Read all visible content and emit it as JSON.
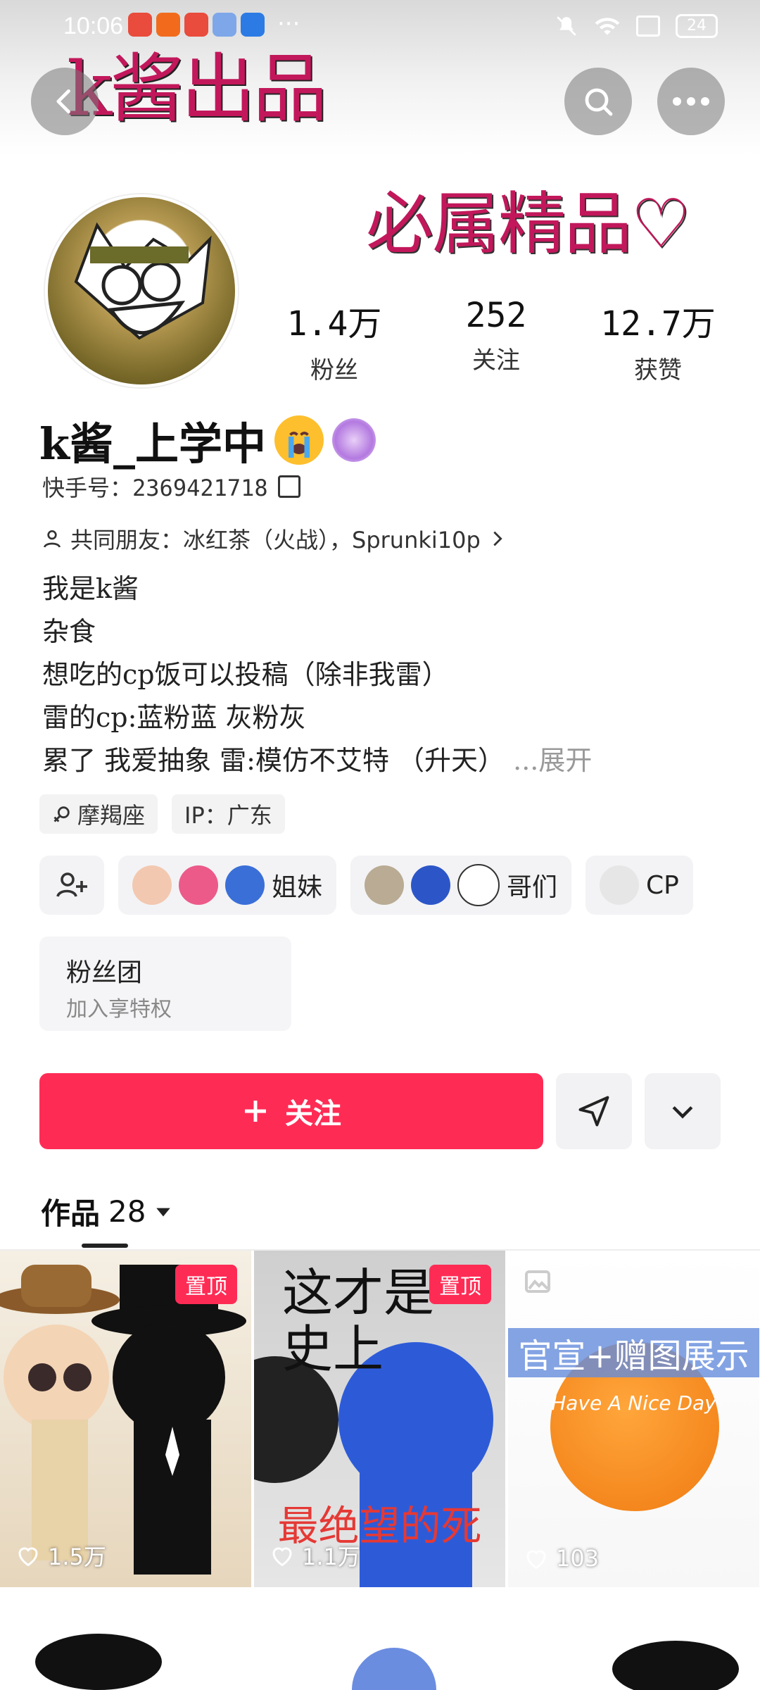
{
  "status_bar": {
    "time": "10:06",
    "battery": "24",
    "app_icons": [
      "huawei-app-icon",
      "233-app-icon",
      "huawei-app-icon",
      "game-app-icon",
      "baidu-app-icon"
    ],
    "more": "···"
  },
  "banner": {
    "text_top": "k酱出品",
    "text_bottom": "必属精品♡"
  },
  "stats": [
    {
      "value": "1.4万",
      "label": "粉丝"
    },
    {
      "value": "252",
      "label": "关注"
    },
    {
      "value": "12.7万",
      "label": "获赞"
    }
  ],
  "profile": {
    "name": "k酱_上学中",
    "kuaishou_id_label": "快手号：",
    "kuaishou_id": "2369421718",
    "mutual_friends": "共同朋友：冰红茶（火战），Sprunki10p",
    "bio_lines": [
      "我是k酱",
      "杂食",
      "想吃的cp饭可以投稿（除非我雷）",
      "雷的cp:蓝粉蓝 灰粉灰",
      "累了 我爱抽象 雷:模仿不艾特 （升天）"
    ],
    "expand": "...展开"
  },
  "tags": [
    {
      "text": "摩羯座",
      "icon": "female-symbol-icon"
    },
    {
      "text": "IP：广东"
    }
  ],
  "groups": [
    {
      "label": "姐妹"
    },
    {
      "label": "哥们"
    },
    {
      "label": "CP"
    }
  ],
  "fan_club": {
    "title": "粉丝团",
    "subtitle": "加入享特权"
  },
  "actions": {
    "follow": "关注"
  },
  "works": {
    "label": "作品",
    "count": "28"
  },
  "videos": [
    {
      "pinned": "置顶",
      "likes": "1.5万"
    },
    {
      "pinned": "置顶",
      "likes": "1.1万",
      "title": "这才是\n史上",
      "bottom_text": "最绝望的死"
    },
    {
      "likes": "103",
      "banner": "官宣+赠图展示",
      "sub": "Have A Nice Day"
    }
  ],
  "colors": {
    "accent": "#fe2c55",
    "banner_text": "#c2185b"
  }
}
